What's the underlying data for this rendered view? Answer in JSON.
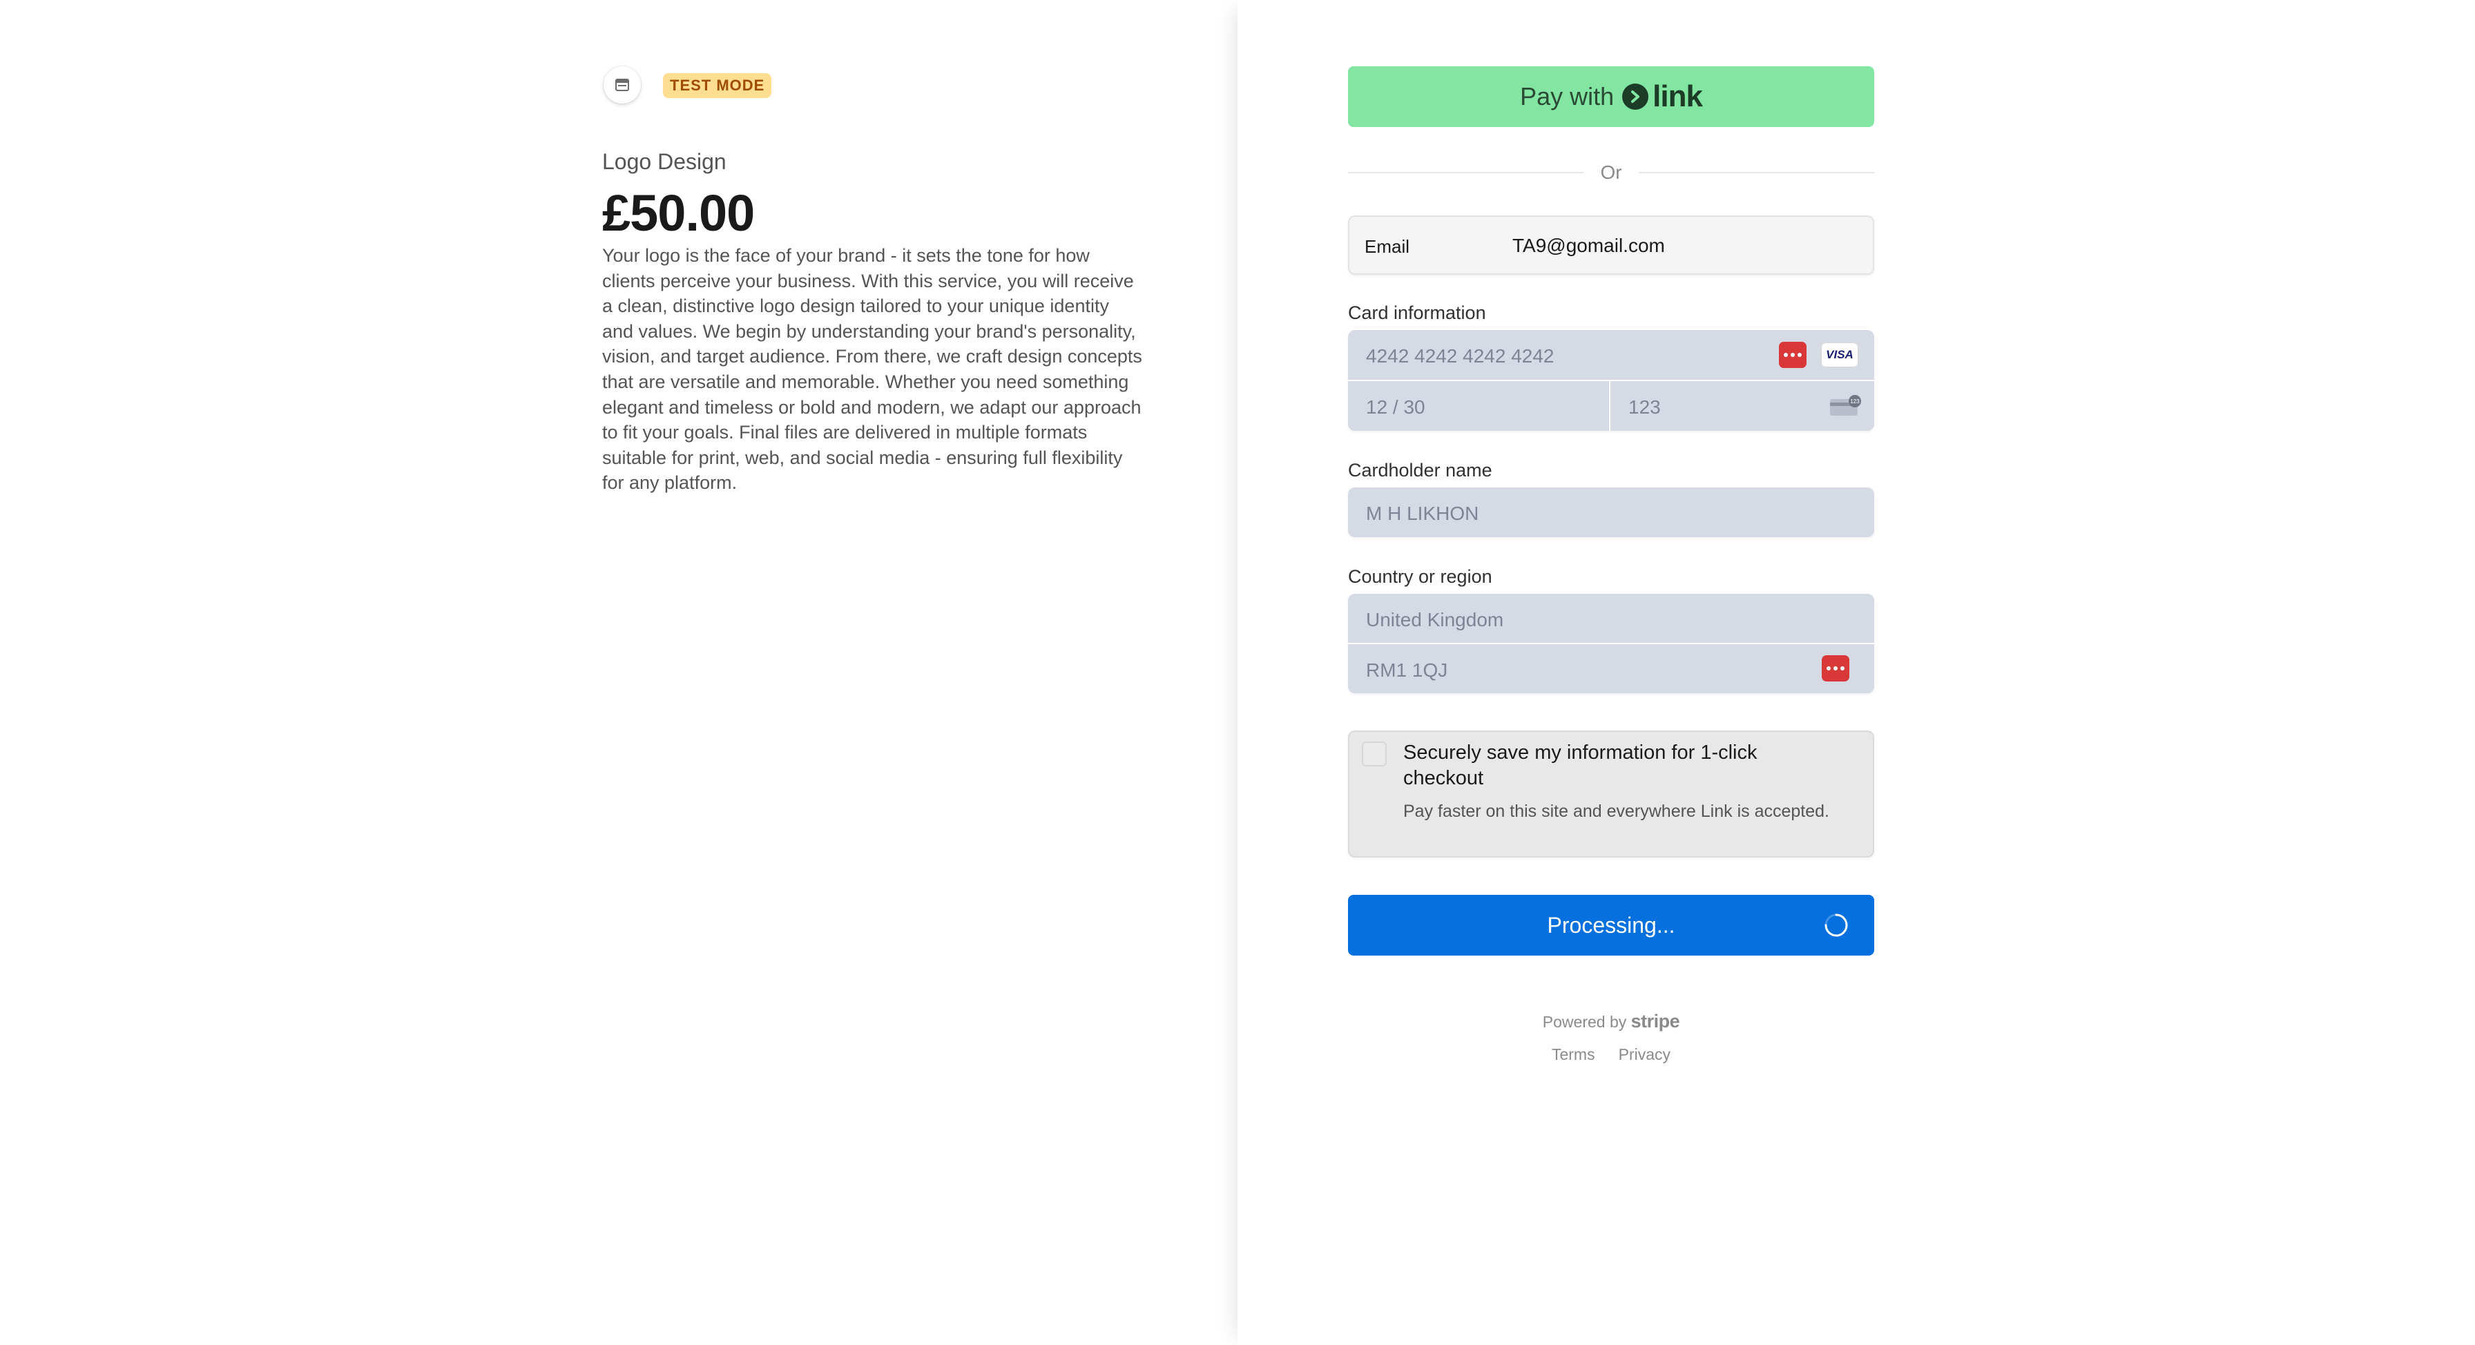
{
  "left": {
    "badge": "TEST MODE",
    "product_name": "Logo Design",
    "price": "£50.00",
    "description": "Your logo is the face of your brand - it sets the tone for how clients perceive your business. With this service, you will receive a clean, distinctive logo design tailored to your unique identity and values. We begin by understanding your brand's personality, vision, and target audience. From there, we craft design concepts that are versatile and memorable. Whether you need something elegant and timeless or bold and modern, we adapt our approach to fit your goals. Final files are delivered in multiple formats suitable for print, web, and social media - ensuring full flexibility for any platform."
  },
  "link_button": {
    "prefix": "Pay with",
    "brand": "link"
  },
  "divider": {
    "label": "Or"
  },
  "email": {
    "label": "Email",
    "value": "TA9@gomail.com"
  },
  "card": {
    "label": "Card information",
    "number_placeholder": "4242 4242 4242 4242",
    "expiry_placeholder": "12 / 30",
    "cvc_placeholder": "123",
    "brand_icon": "visa-icon",
    "brand_text": "VISA"
  },
  "cardholder": {
    "label": "Cardholder name",
    "placeholder": "M H LIKHON"
  },
  "country": {
    "label": "Country or region",
    "value": "United Kingdom",
    "postal_placeholder": "RM1 1QJ"
  },
  "save_info": {
    "title": "Securely save my information for 1-click checkout",
    "subtitle": "Pay faster on this site and everywhere Link is accepted."
  },
  "pay_button": {
    "label": "Processing..."
  },
  "footer": {
    "powered_by": "Powered by",
    "brand": "stripe",
    "terms": "Terms",
    "privacy": "Privacy"
  },
  "colors": {
    "link_green": "#82e5a2",
    "primary_blue": "#0570de",
    "input_fill": "#d5dae5",
    "badge_bg": "#ffde92",
    "badge_text": "#a04c00",
    "autofill_red": "#d93838"
  }
}
